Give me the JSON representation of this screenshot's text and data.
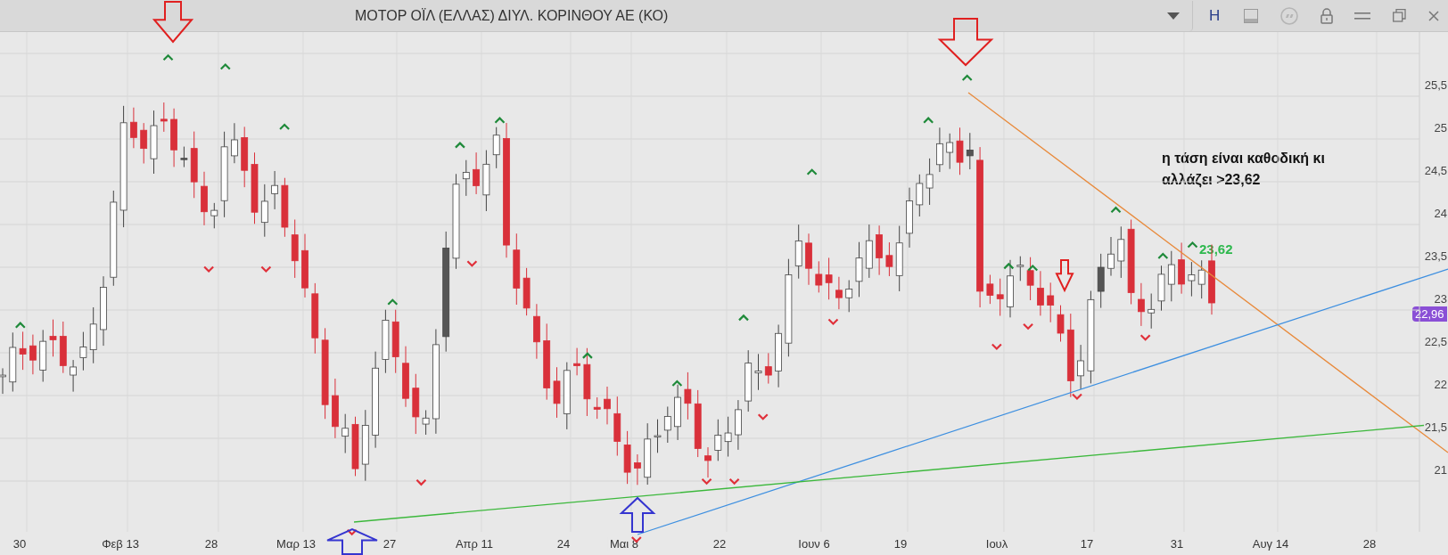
{
  "window": {
    "title": "ΜΟΤΟΡ ΟΪΛ (ΕΛΛΑΣ) ΔΙΥΛ. ΚΟΡΙΝΘΟΥ ΑΕ (ΚΟ)"
  },
  "toolbar": {
    "letter_button": "H"
  },
  "chart": {
    "y_axis_labels": [
      "25,5",
      "25",
      "24,5",
      "24",
      "23,5",
      "23",
      "22,5",
      "22",
      "21,5",
      "21"
    ],
    "x_axis_labels": [
      "30",
      "Φεβ 13",
      "28",
      "Μαρ 13",
      "27",
      "Απρ 11",
      "24",
      "Μαι 8",
      "22",
      "Ιουν 6",
      "19",
      "Ιουλ",
      "17",
      "31",
      "Αυγ 14",
      "28"
    ],
    "last_price": "22,96",
    "level_label": "23,62",
    "note": "η τάση είναι καθοδική κι αλλάζει >23,62"
  }
}
